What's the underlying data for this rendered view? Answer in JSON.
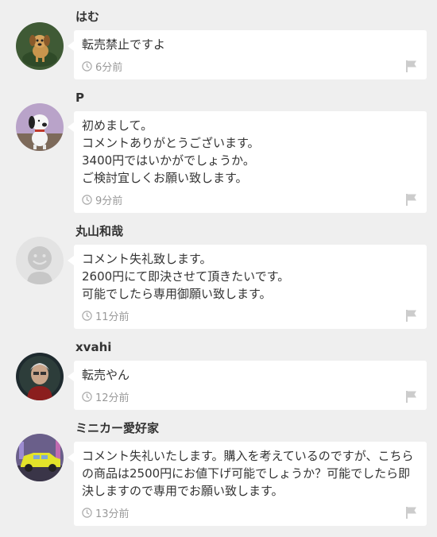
{
  "colors": {
    "background": "#efefef",
    "bubble": "#ffffff",
    "text": "#333333",
    "muted": "#999999",
    "flag": "#cccccc"
  },
  "icons": {
    "clock": "clock-icon",
    "flag": "flag-icon"
  },
  "comments": [
    {
      "username": "はむ",
      "avatar": "dog-photo-avatar",
      "message": "転売禁止ですよ",
      "time": "6分前"
    },
    {
      "username": "P",
      "avatar": "snoopy-photo-avatar",
      "message": "初めまして。\nコメントありがとうございます。\n3400円ではいかがでしょうか。\nご検討宜しくお願い致します。",
      "time": "9分前"
    },
    {
      "username": "丸山和哉",
      "avatar": "default-user-avatar",
      "message": "コメント失礼致します。\n2600円にて即決させて頂きたいです。\n可能でしたら専用御願い致します。",
      "time": "11分前"
    },
    {
      "username": "xvahi",
      "avatar": "person-photo-avatar",
      "message": "転売やん",
      "time": "12分前"
    },
    {
      "username": "ミニカー愛好家",
      "avatar": "car-photo-avatar",
      "message": "コメント失礼いたします。購入を考えているのですが、こちらの商品は2500円にお値下げ可能でしょうか？可能でしたら即決しますので専用でお願い致します。",
      "time": "13分前"
    }
  ]
}
